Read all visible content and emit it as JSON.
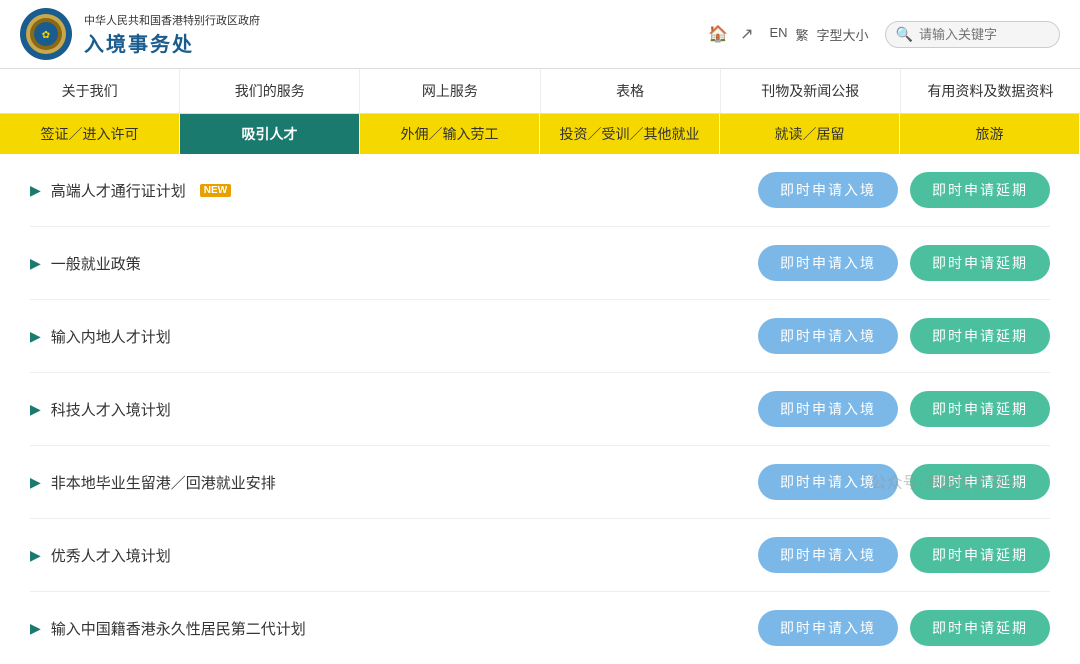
{
  "header": {
    "gov_title": "中华人民共和国香港特别行政区政府",
    "dept_name": "入境事务处",
    "home_icon": "🏠",
    "share_icon": "↗",
    "lang_en": "EN",
    "lang_tc": "繁",
    "font_size": "字型大小",
    "search_placeholder": "请输入关键字"
  },
  "nav_main": {
    "items": [
      {
        "label": "关于我们"
      },
      {
        "label": "我们的服务"
      },
      {
        "label": "网上服务"
      },
      {
        "label": "表格"
      },
      {
        "label": "刊物及新闻公报"
      },
      {
        "label": "有用资料及数据资料"
      }
    ]
  },
  "nav_sub": {
    "items": [
      {
        "label": "签证／进入许可",
        "style": "yellow"
      },
      {
        "label": "吸引人才",
        "style": "teal"
      },
      {
        "label": "外佣／输入劳工",
        "style": "yellow"
      },
      {
        "label": "投资／受训／其他就业",
        "style": "yellow"
      },
      {
        "label": "就读／居留",
        "style": "yellow"
      },
      {
        "label": "旅游",
        "style": "yellow"
      }
    ]
  },
  "list": {
    "items": [
      {
        "title": "高端人才通行证计划",
        "new": true,
        "btn1": "即时申请入境",
        "btn2": "即时申请延期"
      },
      {
        "title": "一般就业政策",
        "new": false,
        "btn1": "即时申请入境",
        "btn2": "即时申请延期"
      },
      {
        "title": "输入内地人才计划",
        "new": false,
        "btn1": "即时申请入境",
        "btn2": "即时申请延期"
      },
      {
        "title": "科技人才入境计划",
        "new": false,
        "btn1": "即时申请入境",
        "btn2": "即时申请延期"
      },
      {
        "title": "非本地毕业生留港／回港就业安排",
        "new": false,
        "btn1": "即时申请入境",
        "btn2": "即时申请延期"
      },
      {
        "title": "优秀人才入境计划",
        "new": false,
        "btn1": "即时申请入境",
        "btn2": "即时申请延期"
      },
      {
        "title": "输入中国籍香港永久性居民第二代计划",
        "new": false,
        "btn1": "即时申请入境",
        "btn2": "即时申请延期"
      }
    ]
  },
  "new_label": "NEW"
}
